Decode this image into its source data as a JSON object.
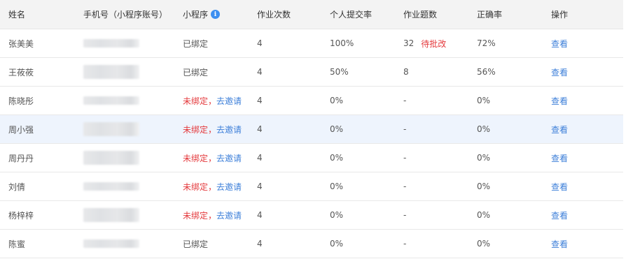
{
  "table": {
    "columns": [
      "姓名",
      "手机号（小程序账号）",
      "小程序",
      "作业次数",
      "个人提交率",
      "作业题数",
      "正确率",
      "操作"
    ],
    "info_icon": "info-icon",
    "bound_label": "已绑定",
    "unbound_label": "未绑定，",
    "invite_label": "去邀请",
    "pending_label": "待批改",
    "view_label": "查看",
    "rows": [
      {
        "name": "张美美",
        "status": "bound",
        "count": "4",
        "rate": "100%",
        "questions": "32",
        "pending": true,
        "correct": "72%"
      },
      {
        "name": "王莜莜",
        "status": "bound",
        "count": "4",
        "rate": "50%",
        "questions": "8",
        "pending": false,
        "correct": "56%"
      },
      {
        "name": "陈晓彤",
        "status": "unbound",
        "count": "4",
        "rate": "0%",
        "questions": "-",
        "pending": false,
        "correct": "0%"
      },
      {
        "name": "周小强",
        "status": "unbound",
        "count": "4",
        "rate": "0%",
        "questions": "-",
        "pending": false,
        "correct": "0%"
      },
      {
        "name": "周丹丹",
        "status": "unbound",
        "count": "4",
        "rate": "0%",
        "questions": "-",
        "pending": false,
        "correct": "0%"
      },
      {
        "name": "刘倩",
        "status": "unbound",
        "count": "4",
        "rate": "0%",
        "questions": "-",
        "pending": false,
        "correct": "0%"
      },
      {
        "name": "杨梓梓",
        "status": "unbound",
        "count": "4",
        "rate": "0%",
        "questions": "-",
        "pending": false,
        "correct": "0%"
      },
      {
        "name": "陈蜜",
        "status": "bound",
        "count": "4",
        "rate": "0%",
        "questions": "-",
        "pending": false,
        "correct": "0%"
      }
    ]
  },
  "colors": {
    "accent": "#3d7fd9",
    "danger": "#e4393c",
    "header_bg": "#f3f3f3",
    "highlight_bg": "#eef4fd"
  }
}
